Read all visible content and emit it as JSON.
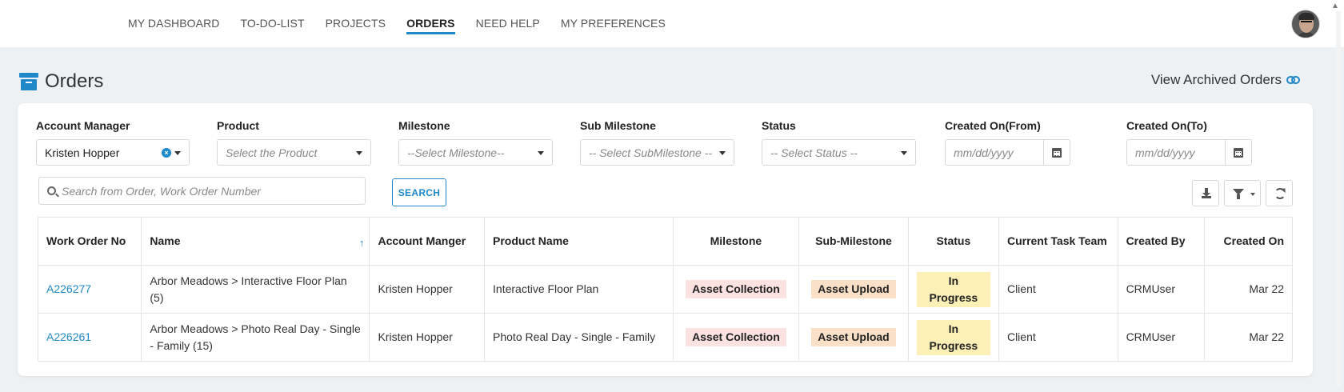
{
  "nav": {
    "items": [
      "MY DASHBOARD",
      "TO-DO-LIST",
      "PROJECTS",
      "ORDERS",
      "NEED HELP",
      "MY PREFERENCES"
    ],
    "active": "ORDERS"
  },
  "header": {
    "title": "Orders",
    "view_archived": "View Archived Orders"
  },
  "filters": {
    "account_manager": {
      "label": "Account Manager",
      "value": "Kristen Hopper"
    },
    "product": {
      "label": "Product",
      "placeholder": "Select the Product"
    },
    "milestone": {
      "label": "Milestone",
      "placeholder": "--Select Milestone--"
    },
    "sub_milestone": {
      "label": "Sub Milestone",
      "placeholder": "-- Select SubMilestone --"
    },
    "status": {
      "label": "Status",
      "placeholder": "-- Select Status --"
    },
    "created_from": {
      "label": "Created On(From)",
      "placeholder": "mm/dd/yyyy"
    },
    "created_to": {
      "label": "Created On(To)",
      "placeholder": "mm/dd/yyyy"
    }
  },
  "search": {
    "placeholder": "Search from Order, Work Order Number",
    "button_label": "SEARCH"
  },
  "table": {
    "columns": {
      "work_order": "Work Order No",
      "name": "Name",
      "account_manager": "Account Manger",
      "product_name": "Product Name",
      "milestone": "Milestone",
      "sub_milestone": "Sub-Milestone",
      "status": "Status",
      "current_task_team": "Current Task Team",
      "created_by": "Created By",
      "created_on": "Created On"
    },
    "sort_indicator": "↑",
    "rows": [
      {
        "work_order": "A226277",
        "name": "Arbor Meadows > Interactive Floor Plan (5)",
        "account_manager": "Kristen Hopper",
        "product_name": "Interactive Floor Plan",
        "milestone": "Asset Collection",
        "sub_milestone": "Asset Upload",
        "status": "In Progress",
        "current_task_team": "Client",
        "created_by": "CRMUser",
        "created_on": "Mar 22"
      },
      {
        "work_order": "A226261",
        "name": "Arbor Meadows > Photo Real Day - Single - Family (15)",
        "account_manager": "Kristen Hopper",
        "product_name": "Photo Real Day - Single - Family",
        "milestone": "Asset Collection",
        "sub_milestone": "Asset Upload",
        "status": "In Progress",
        "current_task_team": "Client",
        "created_by": "CRMUser",
        "created_on": "Mar 22"
      }
    ]
  },
  "colors": {
    "accent": "#1e88c9",
    "milestone_badge": "#fde2e2",
    "submilestone_badge": "#fbe0c8",
    "status_badge": "#fcf0b6"
  }
}
